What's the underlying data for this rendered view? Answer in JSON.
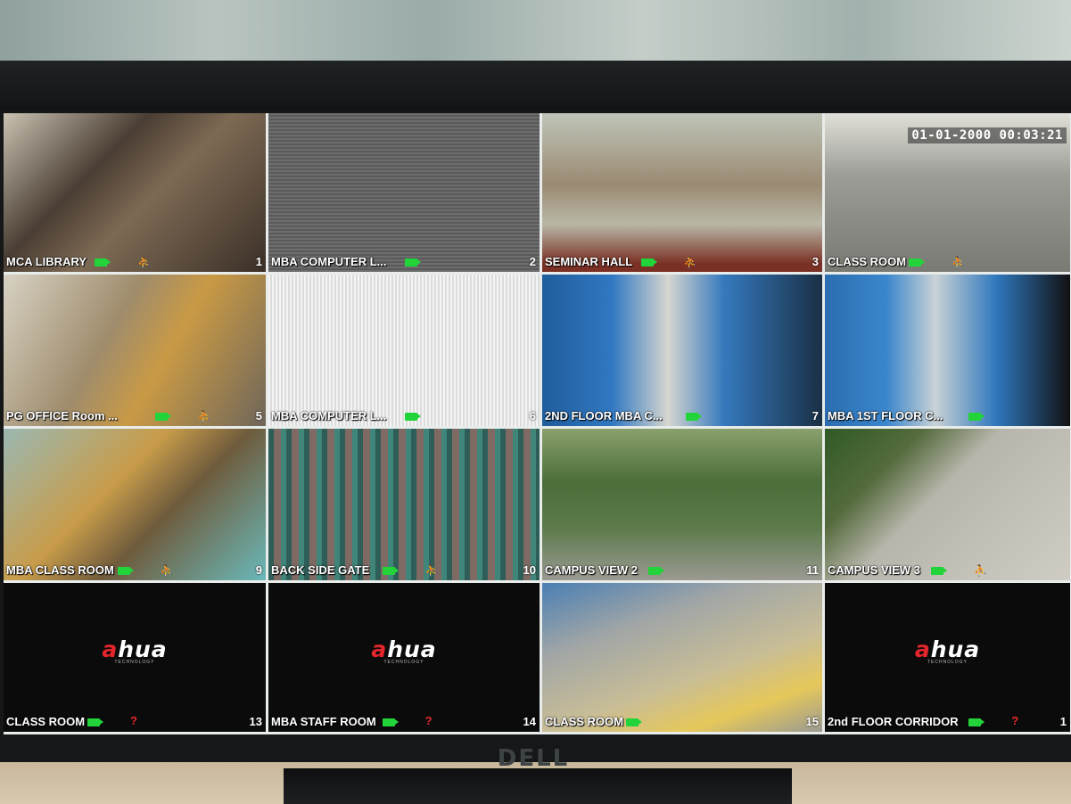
{
  "monitor": {
    "brand": "DELL"
  },
  "timestamp": "01-01-2000 00:03:21",
  "colors": {
    "record_icon": "#22d43a",
    "alert_icon": "#e5292b",
    "logo_red": "#e4262c"
  },
  "logo": {
    "brand_a": "a",
    "brand_rest": "hua",
    "sub": "TECHNOLOGY"
  },
  "channels": [
    {
      "label": "MCA LIBRARY",
      "number": "1",
      "status": "motion",
      "feed": "library"
    },
    {
      "label": "MBA COMPUTER L...",
      "number": "2",
      "status": "recording",
      "feed": "mbacomp"
    },
    {
      "label": "SEMINAR HALL",
      "number": "3",
      "status": "motion",
      "feed": "seminar"
    },
    {
      "label": "CLASS ROOM",
      "number": "",
      "status": "motion",
      "feed": "class1"
    },
    {
      "label": "PG OFFICE  Room ...",
      "number": "5",
      "status": "motion",
      "feed": "pgoffice"
    },
    {
      "label": "MBA COMPUTER L...",
      "number": "6",
      "status": "recording",
      "feed": "mbacomp2"
    },
    {
      "label": "2ND FLOOR MBA C...",
      "number": "7",
      "status": "recording",
      "feed": "2ndfloor"
    },
    {
      "label": "MBA 1ST FLOOR C...",
      "number": "",
      "status": "recording",
      "feed": "mba1st"
    },
    {
      "label": "MBA CLASS ROOM",
      "number": "9",
      "status": "motion",
      "feed": "mbaclass"
    },
    {
      "label": "BACK SIDE GATE",
      "number": "10",
      "status": "motion",
      "feed": "backgate"
    },
    {
      "label": "CAMPUS VIEW 2",
      "number": "11",
      "status": "recording",
      "feed": "campus2"
    },
    {
      "label": "CAMPUS VIEW 3",
      "number": "",
      "status": "motion",
      "feed": "campus3"
    },
    {
      "label": "CLASS ROOM",
      "number": "13",
      "status": "no-signal",
      "feed": "black"
    },
    {
      "label": "MBA STAFF ROOM",
      "number": "14",
      "status": "no-signal",
      "feed": "black"
    },
    {
      "label": "CLASS ROOM",
      "number": "15",
      "status": "recording",
      "feed": "class15"
    },
    {
      "label": "2nd FLOOR CORRIDOR",
      "number": "1",
      "status": "no-signal",
      "feed": "black"
    }
  ],
  "icons": {
    "record": "camera-record-icon",
    "motion": "motion-alert-icon",
    "unknown": "question-mark-icon"
  }
}
